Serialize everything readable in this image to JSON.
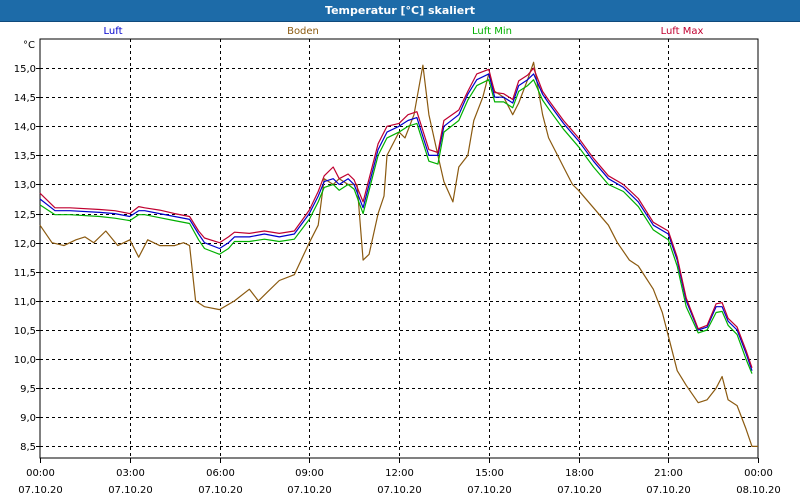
{
  "window": {
    "title": "Temperatur [°C] skaliert"
  },
  "chart_data": {
    "type": "line",
    "ylabel": "°C",
    "ylim": [
      8.3,
      15.5
    ],
    "y_ticks": [
      "15,0",
      "14,5",
      "14,0",
      "13,5",
      "13,0",
      "12,5",
      "12,0",
      "11,5",
      "11,0",
      "10,5",
      "10,0",
      "9,5",
      "9,0",
      "8,5"
    ],
    "y_tick_values": [
      15.0,
      14.5,
      14.0,
      13.5,
      13.0,
      12.5,
      12.0,
      11.5,
      11.0,
      10.5,
      10.0,
      9.5,
      9.0,
      8.5
    ],
    "x_range_hours": [
      0,
      24
    ],
    "x_ticks": [
      {
        "time": "00:00",
        "date": "07.10.20"
      },
      {
        "time": "03:00",
        "date": "07.10.20"
      },
      {
        "time": "06:00",
        "date": "07.10.20"
      },
      {
        "time": "09:00",
        "date": "07.10.20"
      },
      {
        "time": "12:00",
        "date": "07.10.20"
      },
      {
        "time": "15:00",
        "date": "07.10.20"
      },
      {
        "time": "18:00",
        "date": "07.10.20"
      },
      {
        "time": "21:00",
        "date": "07.10.20"
      },
      {
        "time": "00:00",
        "date": "08.10.20"
      }
    ],
    "grid": true,
    "legend_position": "top",
    "series": [
      {
        "name": "Luft",
        "color": "#0000cc",
        "points": [
          [
            0,
            12.75
          ],
          [
            0.5,
            12.55
          ],
          [
            1,
            12.55
          ],
          [
            2,
            12.52
          ],
          [
            2.5,
            12.5
          ],
          [
            3,
            12.45
          ],
          [
            3.3,
            12.55
          ],
          [
            3.5,
            12.55
          ],
          [
            4,
            12.5
          ],
          [
            4.5,
            12.45
          ],
          [
            5,
            12.4
          ],
          [
            5.3,
            12.15
          ],
          [
            5.5,
            12.0
          ],
          [
            6,
            11.9
          ],
          [
            6.3,
            12.0
          ],
          [
            6.5,
            12.1
          ],
          [
            7,
            12.1
          ],
          [
            7.5,
            12.15
          ],
          [
            8,
            12.1
          ],
          [
            8.5,
            12.15
          ],
          [
            9,
            12.5
          ],
          [
            9.3,
            12.8
          ],
          [
            9.5,
            13.05
          ],
          [
            9.8,
            13.1
          ],
          [
            10,
            13.0
          ],
          [
            10.3,
            13.1
          ],
          [
            10.5,
            13.0
          ],
          [
            10.8,
            12.6
          ],
          [
            11,
            13.0
          ],
          [
            11.3,
            13.6
          ],
          [
            11.6,
            13.9
          ],
          [
            12,
            14.0
          ],
          [
            12.3,
            14.1
          ],
          [
            12.6,
            14.15
          ],
          [
            13,
            13.5
          ],
          [
            13.3,
            13.5
          ],
          [
            13.5,
            14.0
          ],
          [
            14,
            14.2
          ],
          [
            14.3,
            14.55
          ],
          [
            14.6,
            14.8
          ],
          [
            15,
            14.9
          ],
          [
            15.2,
            14.5
          ],
          [
            15.5,
            14.5
          ],
          [
            15.8,
            14.4
          ],
          [
            16,
            14.7
          ],
          [
            16.3,
            14.8
          ],
          [
            16.5,
            14.9
          ],
          [
            16.8,
            14.55
          ],
          [
            17,
            14.4
          ],
          [
            17.5,
            14.05
          ],
          [
            18,
            13.75
          ],
          [
            18.5,
            13.4
          ],
          [
            19,
            13.1
          ],
          [
            19.5,
            12.95
          ],
          [
            20,
            12.7
          ],
          [
            20.5,
            12.3
          ],
          [
            21,
            12.15
          ],
          [
            21.3,
            11.7
          ],
          [
            21.6,
            11.0
          ],
          [
            22,
            10.5
          ],
          [
            22.3,
            10.55
          ],
          [
            22.6,
            10.9
          ],
          [
            22.8,
            10.9
          ],
          [
            23,
            10.65
          ],
          [
            23.3,
            10.5
          ],
          [
            23.6,
            10.1
          ],
          [
            23.8,
            9.8
          ]
        ]
      },
      {
        "name": "Boden",
        "color": "#8b5a10",
        "points": [
          [
            0,
            12.3
          ],
          [
            0.4,
            12.0
          ],
          [
            0.8,
            11.95
          ],
          [
            1.2,
            12.05
          ],
          [
            1.5,
            12.1
          ],
          [
            1.8,
            12.0
          ],
          [
            2.2,
            12.2
          ],
          [
            2.6,
            11.95
          ],
          [
            3,
            12.05
          ],
          [
            3.3,
            11.75
          ],
          [
            3.6,
            12.05
          ],
          [
            4,
            11.95
          ],
          [
            4.5,
            11.95
          ],
          [
            4.8,
            12.0
          ],
          [
            5,
            11.95
          ],
          [
            5.2,
            11.0
          ],
          [
            5.5,
            10.9
          ],
          [
            6,
            10.85
          ],
          [
            6.5,
            11.0
          ],
          [
            7,
            11.2
          ],
          [
            7.3,
            11.0
          ],
          [
            7.6,
            11.15
          ],
          [
            8,
            11.35
          ],
          [
            8.5,
            11.45
          ],
          [
            9,
            12.0
          ],
          [
            9.3,
            12.3
          ],
          [
            9.5,
            13.1
          ],
          [
            9.8,
            13.0
          ],
          [
            10,
            13.1
          ],
          [
            10.3,
            13.0
          ],
          [
            10.6,
            13.0
          ],
          [
            10.8,
            11.7
          ],
          [
            11,
            11.8
          ],
          [
            11.3,
            12.5
          ],
          [
            11.5,
            12.8
          ],
          [
            11.6,
            13.5
          ],
          [
            12,
            13.9
          ],
          [
            12.2,
            13.8
          ],
          [
            12.5,
            14.2
          ],
          [
            12.8,
            15.05
          ],
          [
            13,
            14.2
          ],
          [
            13.3,
            13.5
          ],
          [
            13.5,
            13.05
          ],
          [
            13.8,
            12.7
          ],
          [
            14,
            13.3
          ],
          [
            14.3,
            13.5
          ],
          [
            14.5,
            14.1
          ],
          [
            14.8,
            14.5
          ],
          [
            15,
            14.9
          ],
          [
            15.2,
            14.6
          ],
          [
            15.5,
            14.5
          ],
          [
            15.8,
            14.2
          ],
          [
            16,
            14.4
          ],
          [
            16.3,
            14.8
          ],
          [
            16.5,
            15.1
          ],
          [
            16.8,
            14.2
          ],
          [
            17,
            13.8
          ],
          [
            17.3,
            13.5
          ],
          [
            17.5,
            13.3
          ],
          [
            17.8,
            13.0
          ],
          [
            18,
            12.9
          ],
          [
            18.5,
            12.6
          ],
          [
            19,
            12.3
          ],
          [
            19.3,
            12.0
          ],
          [
            19.7,
            11.7
          ],
          [
            20,
            11.6
          ],
          [
            20.5,
            11.2
          ],
          [
            20.8,
            10.8
          ],
          [
            21,
            10.4
          ],
          [
            21.3,
            9.8
          ],
          [
            21.6,
            9.55
          ],
          [
            22,
            9.25
          ],
          [
            22.3,
            9.3
          ],
          [
            22.6,
            9.5
          ],
          [
            22.8,
            9.7
          ],
          [
            23,
            9.3
          ],
          [
            23.3,
            9.2
          ],
          [
            23.6,
            8.8
          ],
          [
            23.8,
            8.5
          ],
          [
            24,
            8.5
          ]
        ]
      },
      {
        "name": "Luft Min",
        "color": "#00b000",
        "points": [
          [
            0,
            12.65
          ],
          [
            0.5,
            12.48
          ],
          [
            1,
            12.48
          ],
          [
            2,
            12.45
          ],
          [
            2.5,
            12.42
          ],
          [
            3,
            12.38
          ],
          [
            3.3,
            12.48
          ],
          [
            3.5,
            12.48
          ],
          [
            4,
            12.43
          ],
          [
            4.5,
            12.38
          ],
          [
            5,
            12.33
          ],
          [
            5.3,
            12.05
          ],
          [
            5.5,
            11.9
          ],
          [
            6,
            11.8
          ],
          [
            6.3,
            11.9
          ],
          [
            6.5,
            12.02
          ],
          [
            7,
            12.02
          ],
          [
            7.5,
            12.06
          ],
          [
            8,
            12.02
          ],
          [
            8.5,
            12.06
          ],
          [
            9,
            12.4
          ],
          [
            9.3,
            12.7
          ],
          [
            9.5,
            12.95
          ],
          [
            9.8,
            13.0
          ],
          [
            10,
            12.9
          ],
          [
            10.3,
            13.0
          ],
          [
            10.5,
            12.92
          ],
          [
            10.8,
            12.5
          ],
          [
            11,
            12.9
          ],
          [
            11.3,
            13.5
          ],
          [
            11.6,
            13.8
          ],
          [
            12,
            13.9
          ],
          [
            12.3,
            14.0
          ],
          [
            12.6,
            14.05
          ],
          [
            13,
            13.4
          ],
          [
            13.3,
            13.35
          ],
          [
            13.5,
            13.9
          ],
          [
            14,
            14.1
          ],
          [
            14.3,
            14.45
          ],
          [
            14.6,
            14.7
          ],
          [
            15,
            14.8
          ],
          [
            15.2,
            14.42
          ],
          [
            15.5,
            14.42
          ],
          [
            15.8,
            14.32
          ],
          [
            16,
            14.6
          ],
          [
            16.3,
            14.7
          ],
          [
            16.5,
            14.8
          ],
          [
            16.8,
            14.45
          ],
          [
            17,
            14.3
          ],
          [
            17.5,
            13.95
          ],
          [
            18,
            13.65
          ],
          [
            18.5,
            13.3
          ],
          [
            19,
            13.0
          ],
          [
            19.5,
            12.88
          ],
          [
            20,
            12.62
          ],
          [
            20.5,
            12.22
          ],
          [
            21,
            12.05
          ],
          [
            21.3,
            11.6
          ],
          [
            21.6,
            10.9
          ],
          [
            22,
            10.45
          ],
          [
            22.3,
            10.5
          ],
          [
            22.6,
            10.8
          ],
          [
            22.8,
            10.82
          ],
          [
            23,
            10.58
          ],
          [
            23.3,
            10.42
          ],
          [
            23.6,
            10.0
          ],
          [
            23.8,
            9.75
          ]
        ]
      },
      {
        "name": "Luft Max",
        "color": "#c00030",
        "points": [
          [
            0,
            12.85
          ],
          [
            0.5,
            12.6
          ],
          [
            1,
            12.6
          ],
          [
            2,
            12.57
          ],
          [
            2.5,
            12.55
          ],
          [
            3,
            12.5
          ],
          [
            3.3,
            12.62
          ],
          [
            3.5,
            12.6
          ],
          [
            4,
            12.56
          ],
          [
            4.5,
            12.5
          ],
          [
            5,
            12.45
          ],
          [
            5.3,
            12.2
          ],
          [
            5.5,
            12.08
          ],
          [
            6,
            12.0
          ],
          [
            6.3,
            12.1
          ],
          [
            6.5,
            12.18
          ],
          [
            7,
            12.16
          ],
          [
            7.5,
            12.2
          ],
          [
            8,
            12.16
          ],
          [
            8.5,
            12.2
          ],
          [
            9,
            12.56
          ],
          [
            9.3,
            12.88
          ],
          [
            9.5,
            13.15
          ],
          [
            9.8,
            13.3
          ],
          [
            10,
            13.1
          ],
          [
            10.3,
            13.18
          ],
          [
            10.5,
            13.08
          ],
          [
            10.8,
            12.7
          ],
          [
            11,
            13.1
          ],
          [
            11.3,
            13.7
          ],
          [
            11.6,
            14.0
          ],
          [
            12,
            14.05
          ],
          [
            12.3,
            14.2
          ],
          [
            12.6,
            14.25
          ],
          [
            13,
            13.6
          ],
          [
            13.3,
            13.55
          ],
          [
            13.5,
            14.1
          ],
          [
            14,
            14.28
          ],
          [
            14.3,
            14.6
          ],
          [
            14.6,
            14.9
          ],
          [
            15,
            14.98
          ],
          [
            15.2,
            14.58
          ],
          [
            15.5,
            14.56
          ],
          [
            15.8,
            14.46
          ],
          [
            16,
            14.78
          ],
          [
            16.3,
            14.88
          ],
          [
            16.5,
            15.0
          ],
          [
            16.8,
            14.6
          ],
          [
            17,
            14.45
          ],
          [
            17.5,
            14.1
          ],
          [
            18,
            13.8
          ],
          [
            18.5,
            13.45
          ],
          [
            19,
            13.15
          ],
          [
            19.5,
            13.0
          ],
          [
            20,
            12.76
          ],
          [
            20.5,
            12.35
          ],
          [
            21,
            12.2
          ],
          [
            21.3,
            11.75
          ],
          [
            21.6,
            11.05
          ],
          [
            22,
            10.52
          ],
          [
            22.3,
            10.58
          ],
          [
            22.6,
            10.95
          ],
          [
            22.8,
            10.97
          ],
          [
            23,
            10.7
          ],
          [
            23.3,
            10.55
          ],
          [
            23.6,
            10.15
          ],
          [
            23.8,
            9.85
          ]
        ]
      }
    ]
  }
}
